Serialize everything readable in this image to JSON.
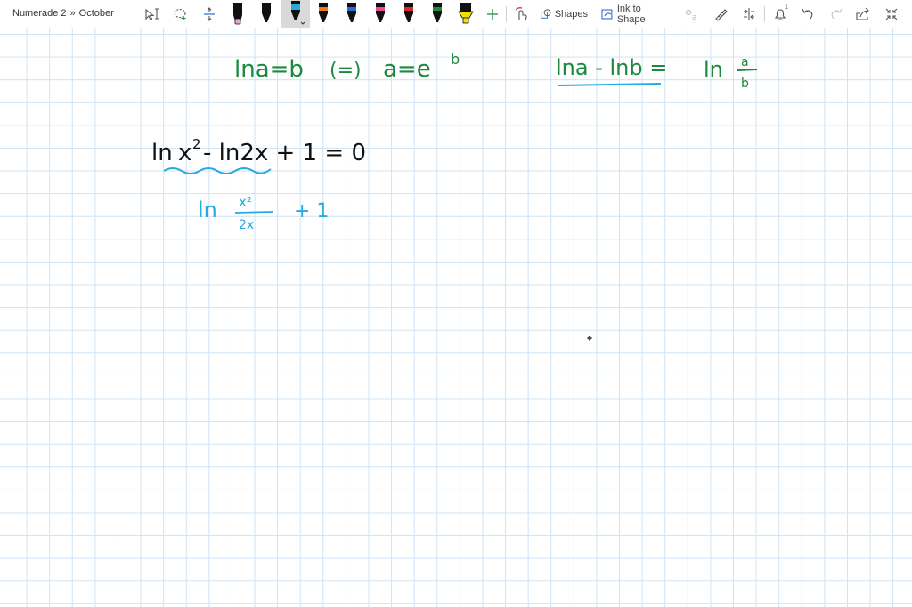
{
  "breadcrumb": {
    "notebook": "Numerade 2",
    "separator": "»",
    "page": "October"
  },
  "toolbar": {
    "shapes_label": "Shapes",
    "ink_to_shape_label": "Ink to Shape",
    "notification_count": "1"
  },
  "pens": [
    {
      "name": "black-pen",
      "color": "#111111",
      "tip": "#e8a6d6"
    },
    {
      "name": "black-pen-2",
      "color": "#111111",
      "tip": "#111111"
    },
    {
      "name": "cyan-pen",
      "color": "#2aa7db",
      "tip": "#2aa7db",
      "selected": true
    },
    {
      "name": "orange-pen",
      "color": "#111111",
      "tip": "#f07b1f"
    },
    {
      "name": "blue-pen",
      "color": "#111111",
      "tip": "#1f6fe0"
    },
    {
      "name": "pink-pen",
      "color": "#111111",
      "tip": "#e84a8f"
    },
    {
      "name": "red-pen",
      "color": "#111111",
      "tip": "#d9262b"
    },
    {
      "name": "green-pen",
      "color": "#111111",
      "tip": "#1b8a3c"
    },
    {
      "name": "yellow-highlighter",
      "color": "#111111",
      "tip": "#f2e200"
    }
  ],
  "colors": {
    "ink_green": "#1b8a3c",
    "ink_cyan": "#27a9e1",
    "ink_black": "#111111",
    "grid": "#cfe3f3"
  },
  "notes": {
    "rule1_left": "lna=b",
    "rule1_iff": "(=)",
    "rule1_right": "a=e",
    "rule1_exp": "b",
    "rule2_left": "lna - lnb =",
    "rule2_ln": "ln",
    "rule2_num": "a",
    "rule2_den": "b",
    "eq_ln": "ln",
    "eq_x": "x",
    "eq_sq": "2",
    "eq_rest": "-  ln2x  + 1  = 0",
    "step_ln": "ln",
    "step_num": "x²",
    "step_den": "2x",
    "step_plus": "+ 1"
  }
}
